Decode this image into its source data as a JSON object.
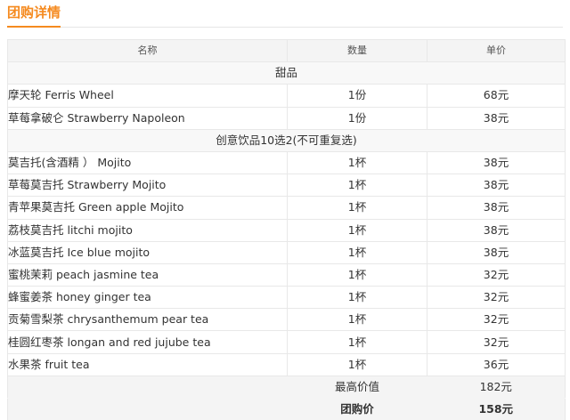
{
  "section": {
    "title": "团购详情"
  },
  "table": {
    "headers": {
      "name": "名称",
      "quantity": "数量",
      "price": "单价"
    },
    "groups": [
      {
        "title": "甜品",
        "items": [
          {
            "name": "摩天轮 Ferris Wheel",
            "quantity": "1份",
            "price": "68元"
          },
          {
            "name": "草莓拿破仑 Strawberry Napoleon",
            "quantity": "1份",
            "price": "38元"
          }
        ]
      },
      {
        "title": "创意饮品10选2(不可重复选)",
        "items": [
          {
            "name": "莫吉托(含酒精 ） Mojito",
            "quantity": "1杯",
            "price": "38元"
          },
          {
            "name": "草莓莫吉托 Strawberry Mojito",
            "quantity": "1杯",
            "price": "38元"
          },
          {
            "name": "青苹果莫吉托 Green apple Mojito",
            "quantity": "1杯",
            "price": "38元"
          },
          {
            "name": "荔枝莫吉托 litchi mojito",
            "quantity": "1杯",
            "price": "38元"
          },
          {
            "name": "冰蓝莫吉托 Ice blue mojito",
            "quantity": "1杯",
            "price": "38元"
          },
          {
            "name": "蜜桃茉莉 peach jasmine tea",
            "quantity": "1杯",
            "price": "32元"
          },
          {
            "name": "蜂蜜姜茶 honey ginger tea",
            "quantity": "1杯",
            "price": "32元"
          },
          {
            "name": "贡菊雪梨茶 chrysanthemum pear tea",
            "quantity": "1杯",
            "price": "32元"
          },
          {
            "name": "桂圆红枣茶 longan and red jujube tea",
            "quantity": "1杯",
            "price": "32元"
          },
          {
            "name": "水果茶 fruit tea",
            "quantity": "1杯",
            "price": "36元"
          }
        ]
      }
    ],
    "summary": {
      "max_value_label": "最高价值",
      "max_value": "182元",
      "group_price_label": "团购价",
      "group_price": "158元"
    }
  },
  "colors": {
    "accent": "#f58a1f",
    "header_bg": "#f4f4f4",
    "border": "#e8e8e8"
  }
}
